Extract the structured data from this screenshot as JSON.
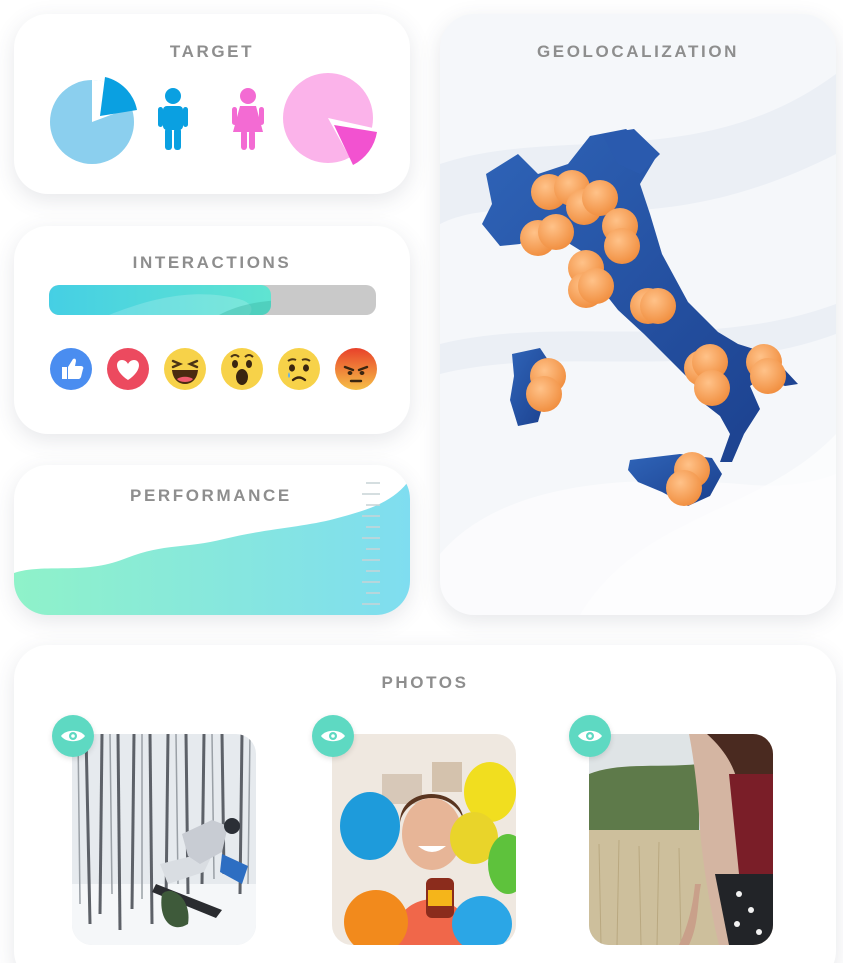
{
  "target": {
    "title": "TARGET",
    "male": {
      "icon": "male-person-icon",
      "color": "#0aa0e1",
      "share": 0.17
    },
    "female": {
      "icon": "female-person-icon",
      "color": "#f36bd3",
      "share": 0.2
    }
  },
  "interactions": {
    "title": "INTERACTIONS",
    "progress": 0.68,
    "reactions": [
      {
        "icon": "like-reaction-icon"
      },
      {
        "icon": "love-reaction-icon"
      },
      {
        "icon": "haha-reaction-icon"
      },
      {
        "icon": "wow-reaction-icon"
      },
      {
        "icon": "sad-reaction-icon"
      },
      {
        "icon": "angry-reaction-icon"
      }
    ]
  },
  "performance": {
    "title": "PERFORMANCE"
  },
  "geo": {
    "title": "GEOLOCALIZATION",
    "map": "italy-map",
    "marker_color": "#f6983a"
  },
  "photos": {
    "title": "PHOTOS",
    "items": [
      {
        "subject": "snowboarder in snowy forest",
        "icon": "eye-icon"
      },
      {
        "subject": "woman with colorful balloons",
        "icon": "eye-icon"
      },
      {
        "subject": "person in wheat field",
        "icon": "eye-icon"
      }
    ]
  }
}
